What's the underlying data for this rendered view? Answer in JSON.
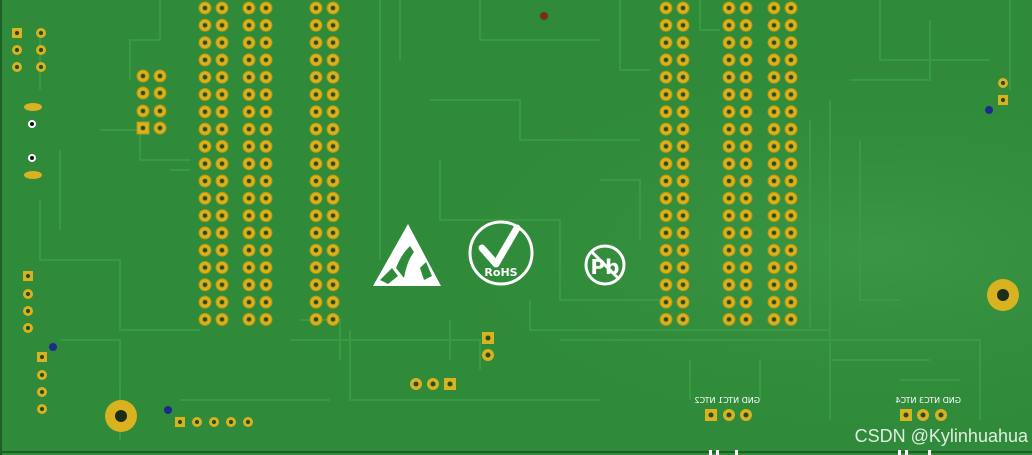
{
  "board": {
    "colors": {
      "soldermask": "#2f8a3a",
      "soldermask_dark": "#267a31",
      "trace": "#3a9a45",
      "pad": "#d9b21f",
      "pad_hole": "#2a4a24",
      "silkscreen": "#ffffff",
      "via_blue": "#1a2d8a"
    },
    "icons": {
      "esd": "esd-warning-icon",
      "rohs": "rohs-compliant-icon",
      "pbfree": "lead-free-icon"
    },
    "labels": {
      "rohs_text": "RoHS",
      "pb_text": "Pb",
      "connector_left": "GND NTC1 NTC2",
      "connector_right": "GND NTC3 NTC4"
    }
  },
  "watermark": "CSDN @Kylinhuahua"
}
